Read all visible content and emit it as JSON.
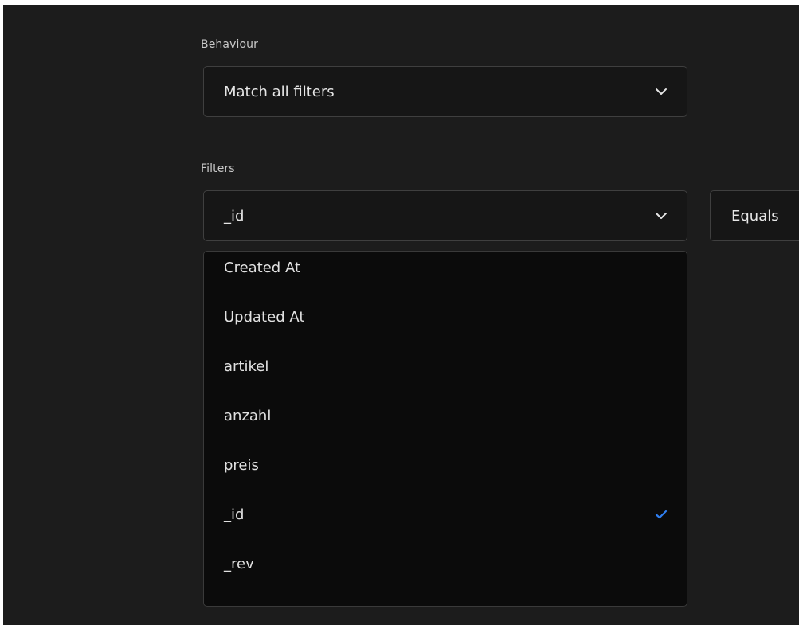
{
  "behaviour": {
    "label": "Behaviour",
    "select_value": "Match all filters",
    "chevron_icon": "chevron-down-icon"
  },
  "filters": {
    "label": "Filters",
    "field_value": "_id",
    "operator_value": "Equals",
    "chevron_icon": "chevron-down-icon"
  },
  "dropdown": {
    "options": [
      {
        "label": "Created At",
        "selected": false
      },
      {
        "label": "Updated At",
        "selected": false
      },
      {
        "label": "artikel",
        "selected": false
      },
      {
        "label": "anzahl",
        "selected": false
      },
      {
        "label": "preis",
        "selected": false
      },
      {
        "label": "_id",
        "selected": true
      },
      {
        "label": "_rev",
        "selected": false
      }
    ],
    "check_icon": "check-icon"
  },
  "colors": {
    "background": "#1c1c1c",
    "menu_background": "#0b0b0b",
    "text": "#e1e1e1",
    "label_text": "#c9c9c9",
    "border": "#3f3f3f",
    "accent": "#2f7ff2"
  }
}
